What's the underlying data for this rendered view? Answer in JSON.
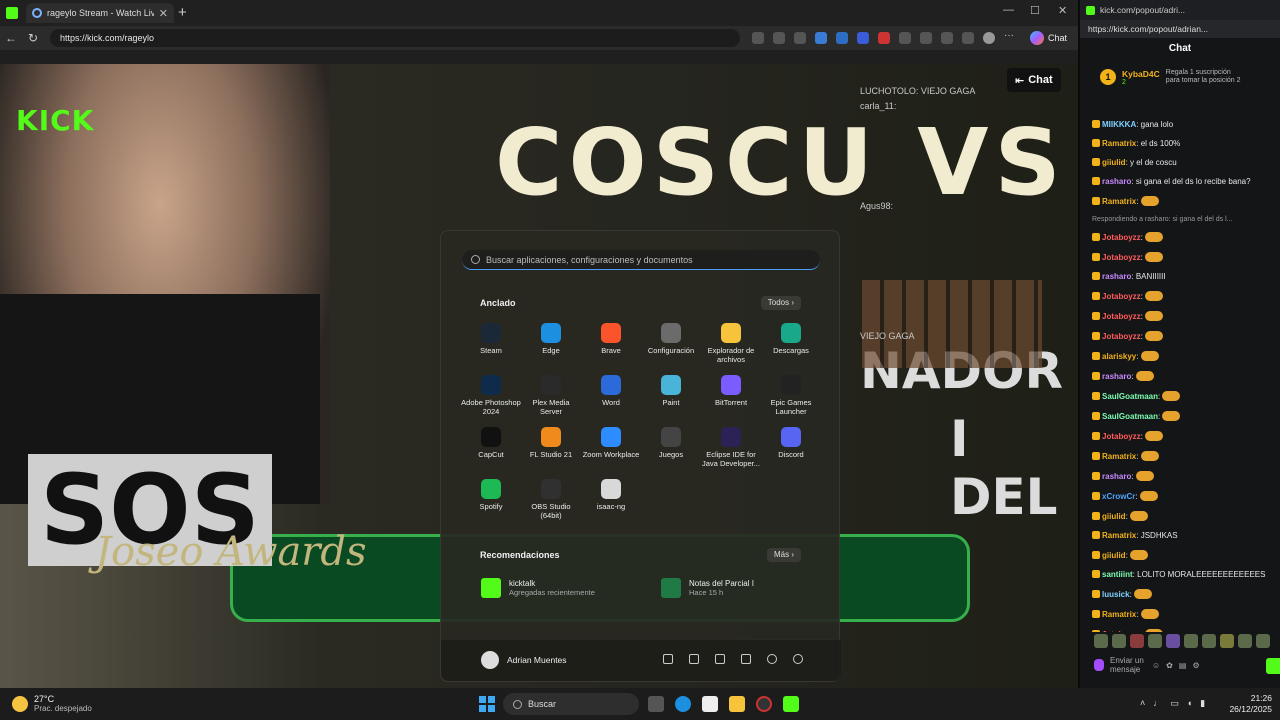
{
  "browser": {
    "tab_title": "rageylo Stream - Watch Live o",
    "new_tab_label": "+",
    "url": "https://kick.com/rageylo",
    "copilot_label": "Chat"
  },
  "video": {
    "logo": "KICK",
    "headline": "COSCU VS",
    "left_sign": "SOS",
    "awards": "Joseo Awards",
    "right_text_1": "NADOR",
    "right_text_2": "I DEL",
    "chat_button": "Chat",
    "overlay_chat": [
      "LUCHOTOLO: VIEJO GAGA",
      "carla_11:",
      "Agus98:",
      "VIEJO GAGA"
    ]
  },
  "start_menu": {
    "search_placeholder": "Buscar aplicaciones, configuraciones y documentos",
    "pinned_title": "Anclado",
    "all_label": "Todos ›",
    "apps": [
      {
        "label": "Steam",
        "color": "#1b2838",
        "icon": "steam-icon"
      },
      {
        "label": "Edge",
        "color": "#1d8fe1",
        "icon": "edge-icon"
      },
      {
        "label": "Brave",
        "color": "#fb542b",
        "icon": "brave-icon"
      },
      {
        "label": "Configuración",
        "color": "#6b6b6b",
        "icon": "settings-icon"
      },
      {
        "label": "Explorador de archivos",
        "color": "#f6c33b",
        "icon": "folder-icon"
      },
      {
        "label": "Descargas",
        "color": "#19a88a",
        "icon": "downloads-icon"
      },
      {
        "label": "Adobe Photoshop 2024",
        "color": "#0f2b4c",
        "icon": "photoshop-icon"
      },
      {
        "label": "Plex Media Server",
        "color": "#2a2a2a",
        "icon": "plex-icon"
      },
      {
        "label": "Word",
        "color": "#2b6ad8",
        "icon": "word-icon"
      },
      {
        "label": "Paint",
        "color": "#4ab3d8",
        "icon": "paint-icon"
      },
      {
        "label": "BitTorrent",
        "color": "#7a5cff",
        "icon": "bittorrent-icon"
      },
      {
        "label": "Epic Games Launcher",
        "color": "#222222",
        "icon": "epic-icon"
      },
      {
        "label": "CapCut",
        "color": "#111111",
        "icon": "capcut-icon"
      },
      {
        "label": "FL Studio 21",
        "color": "#f08a1c",
        "icon": "flstudio-icon"
      },
      {
        "label": "Zoom Workplace",
        "color": "#2d8cff",
        "icon": "zoom-icon"
      },
      {
        "label": "Juegos",
        "color": "#444444",
        "icon": "games-folder-icon"
      },
      {
        "label": "Eclipse IDE for Java Developer...",
        "color": "#2c2255",
        "icon": "eclipse-icon"
      },
      {
        "label": "Discord",
        "color": "#5865f2",
        "icon": "discord-icon"
      },
      {
        "label": "Spotify",
        "color": "#1db954",
        "icon": "spotify-icon"
      },
      {
        "label": "OBS Studio (64bit)",
        "color": "#303030",
        "icon": "obs-icon"
      },
      {
        "label": "isaac-ng",
        "color": "#d8d8d8",
        "icon": "isaac-icon"
      }
    ],
    "recs_title": "Recomendaciones",
    "more_label": "Más ›",
    "recs": [
      {
        "name": "kicktalk",
        "sub": "Agregadas recientemente",
        "color": "#53fc18"
      },
      {
        "name": "Notas del Parcial I",
        "sub": "Hace 15 h",
        "color": "#1f7a45"
      }
    ],
    "user_name": "Adrian Muentes"
  },
  "popout": {
    "title": "kick.com/popout/adri...",
    "url": "https://kick.com/popout/adrian...",
    "header": "Chat",
    "gifter": "KybaD4C",
    "gift_count": "1",
    "gift_count_small": "2",
    "gift_text": "Regala 1 suscripción para tomar la posición 2",
    "messages": [
      {
        "user": "MIIKKKA",
        "text": "gana lolo",
        "color": "#7cd3ff"
      },
      {
        "user": "Ramatrix",
        "text": "el ds 100%",
        "color": "#f2b21a"
      },
      {
        "user": "giiulid",
        "text": "y el de coscu",
        "color": "#f2b21a"
      },
      {
        "user": "rasharo",
        "text": "si gana el del ds lo recibe bana?",
        "color": "#c78bff"
      },
      {
        "user": "Ramatrix",
        "text": "",
        "color": "#f2b21a"
      },
      {
        "user": "Jotaboyzz",
        "text": "",
        "color": "#ff5b5b"
      },
      {
        "user": "Jotaboyzz",
        "text": "",
        "color": "#ff5b5b"
      },
      {
        "user": "rasharo",
        "text": "BANIIIIII",
        "color": "#c78bff"
      },
      {
        "user": "Jotaboyzz",
        "text": "",
        "color": "#ff5b5b"
      },
      {
        "user": "Jotaboyzz",
        "text": "",
        "color": "#ff5b5b"
      },
      {
        "user": "Jotaboyzz",
        "text": "",
        "color": "#ff5b5b"
      },
      {
        "user": "alariskyy",
        "text": "",
        "color": "#f2b21a"
      },
      {
        "user": "rasharo",
        "text": "",
        "color": "#c78bff"
      },
      {
        "user": "SaulGoatmaan",
        "text": "",
        "color": "#7cffb1"
      },
      {
        "user": "SaulGoatmaan",
        "text": "",
        "color": "#7cffb1"
      },
      {
        "user": "Jotaboyzz",
        "text": "",
        "color": "#ff5b5b"
      },
      {
        "user": "Ramatrix",
        "text": "",
        "color": "#f2b21a"
      },
      {
        "user": "rasharo",
        "text": "",
        "color": "#c78bff"
      },
      {
        "user": "xCrowCr",
        "text": "",
        "color": "#4da3ff"
      },
      {
        "user": "giiulid",
        "text": "",
        "color": "#f2b21a"
      },
      {
        "user": "Ramatrix",
        "text": "JSDHKAS",
        "color": "#f2b21a"
      },
      {
        "user": "giiulid",
        "text": "",
        "color": "#f2b21a"
      },
      {
        "user": "santiiint",
        "text": "LOLITO MORALEEEEEEEEEEEES",
        "color": "#7cffb1"
      },
      {
        "user": "luusick",
        "text": "",
        "color": "#7cd3ff"
      },
      {
        "user": "Ramatrix",
        "text": "",
        "color": "#f2b21a"
      },
      {
        "user": "Jotaboyzz",
        "text": "",
        "color": "#ff5b5b"
      }
    ],
    "reply_text": "Respondiendo a rasharo: si gana el del ds l...",
    "send_placeholder": "Enviar un mensaje"
  },
  "taskbar": {
    "temperature": "27°C",
    "weather": "Prac. despejado",
    "search_label": "Buscar",
    "time": "21:26",
    "date": "26/12/2025"
  }
}
